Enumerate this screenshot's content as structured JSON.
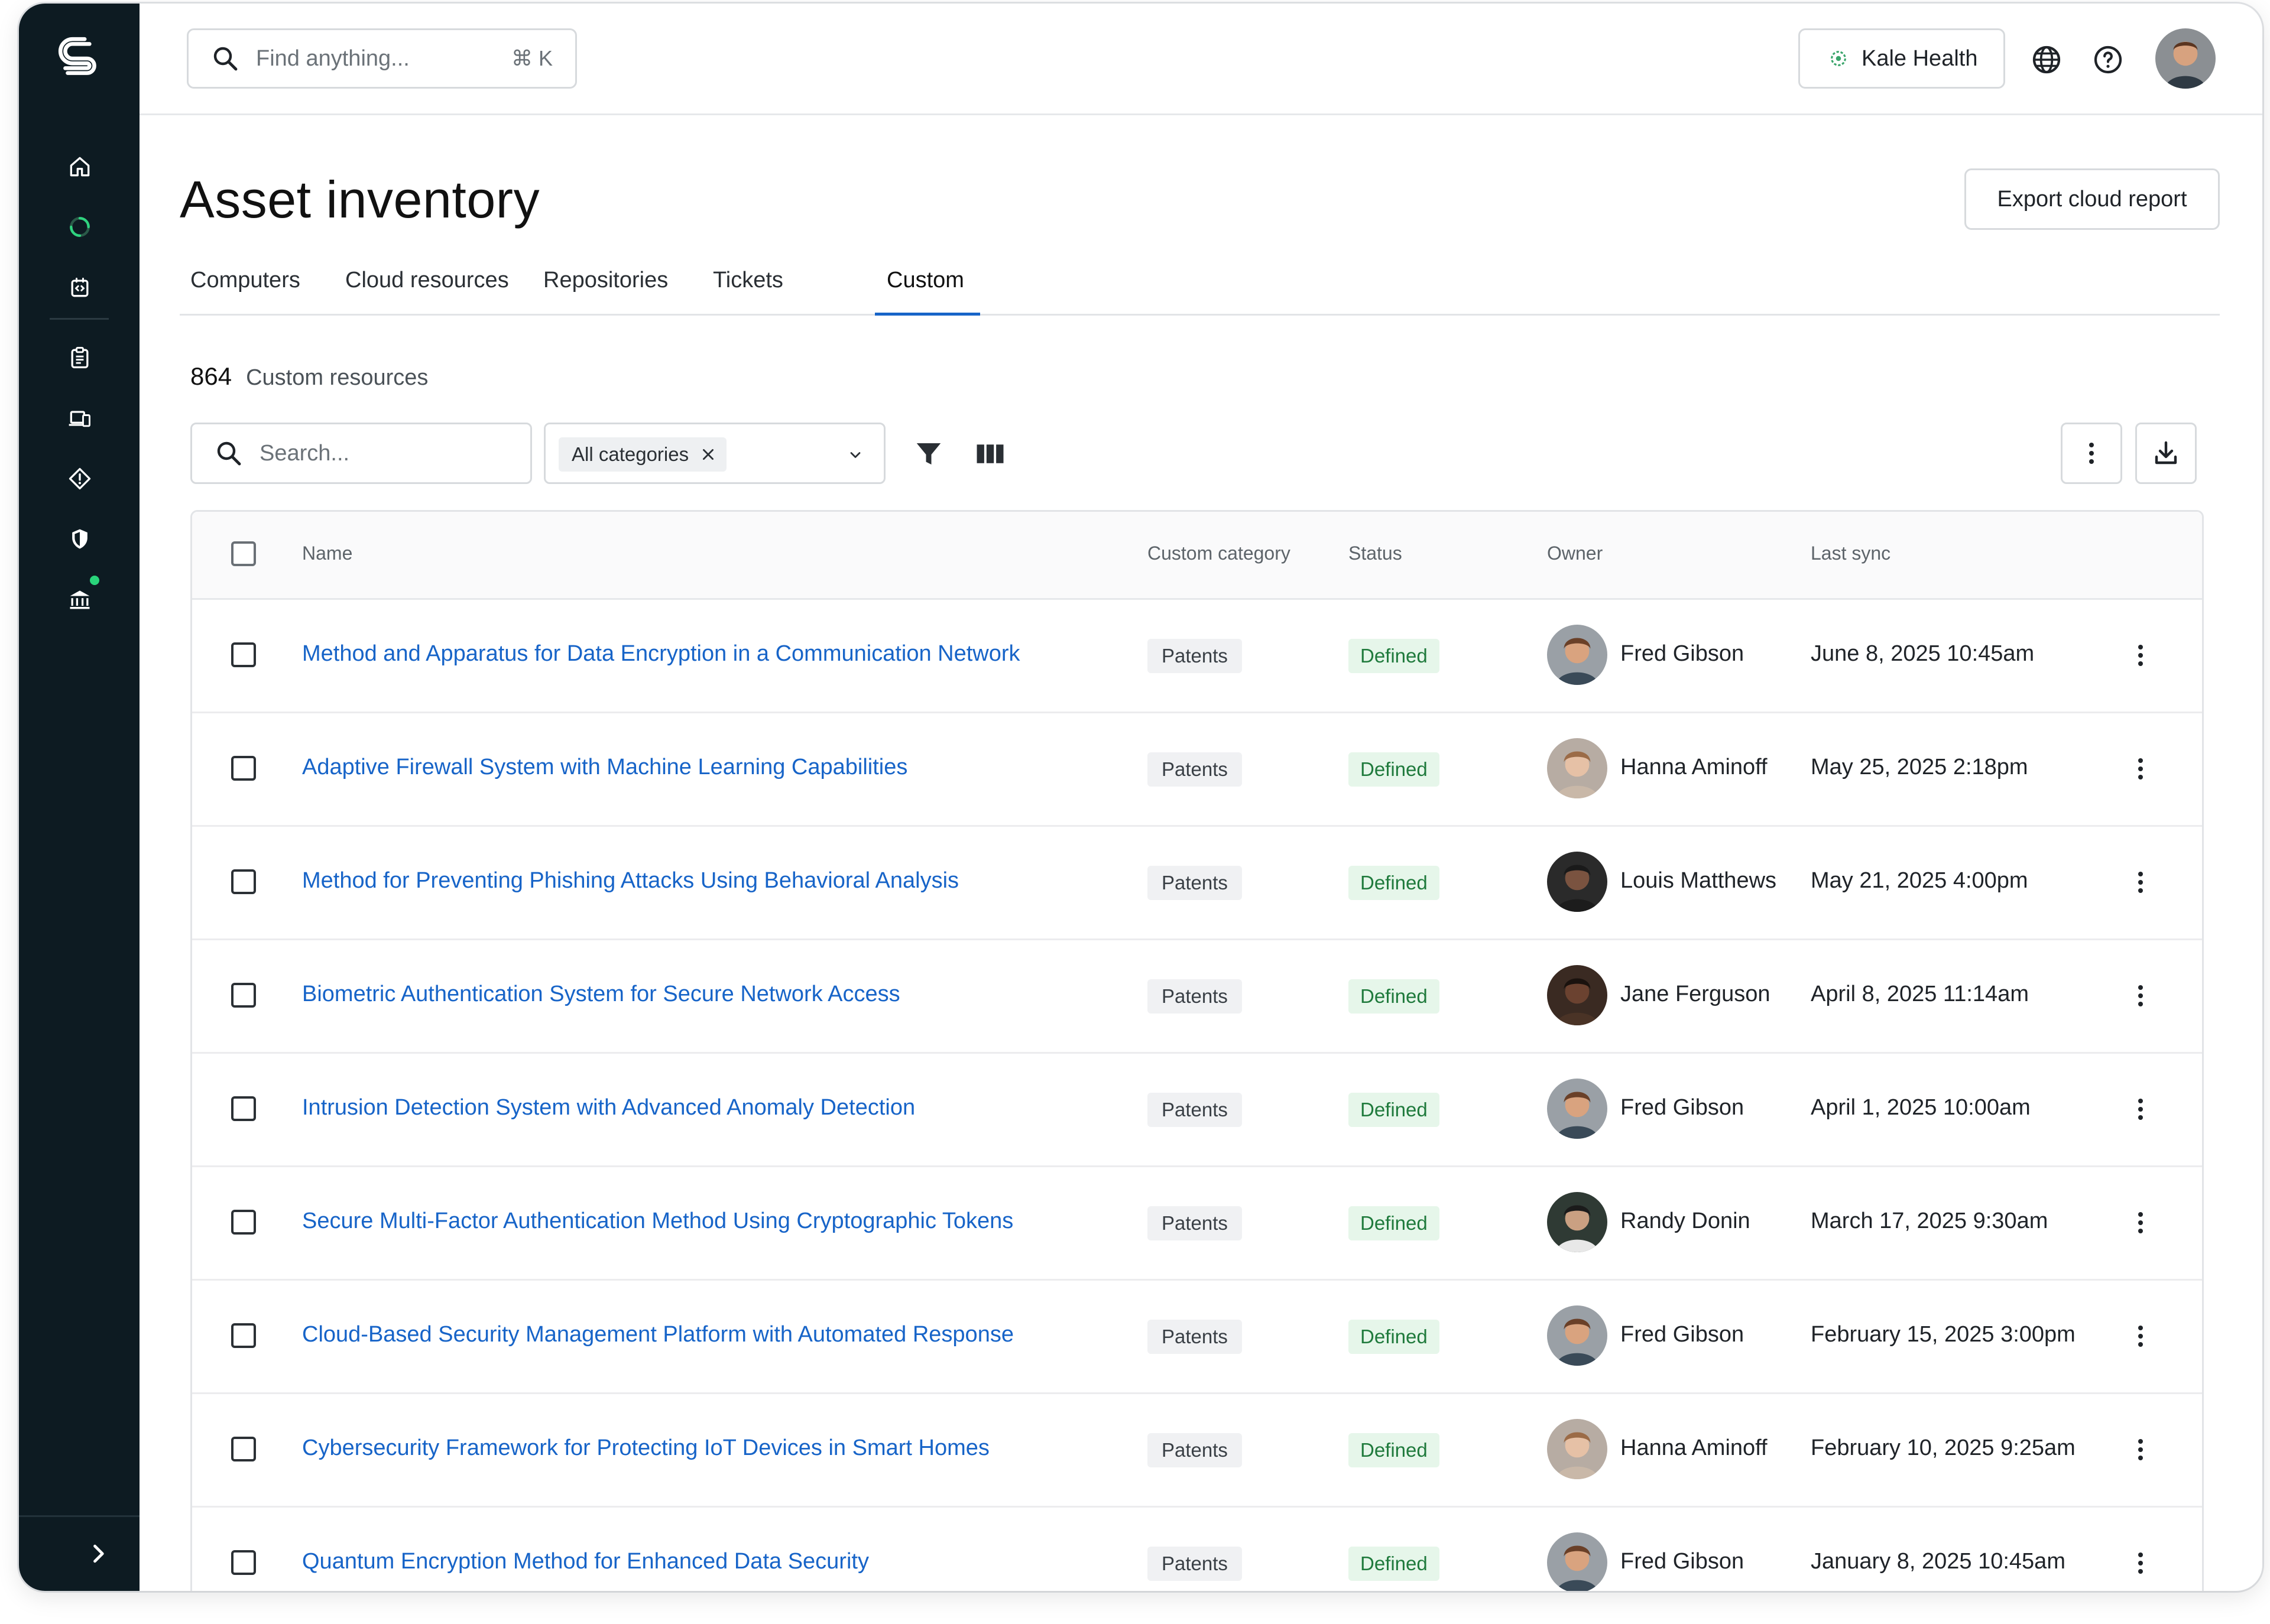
{
  "header": {
    "search_placeholder": "Find anything...",
    "search_shortcut": "⌘ K",
    "org_name": "Kale Health"
  },
  "page": {
    "title": "Asset inventory",
    "export_label": "Export cloud report",
    "tabs": [
      {
        "label": "Computers"
      },
      {
        "label": "Cloud resources"
      },
      {
        "label": "Repositories"
      },
      {
        "label": "Tickets"
      },
      {
        "label": "Custom"
      }
    ],
    "active_tab": "Custom",
    "count": "864",
    "count_label": "Custom resources"
  },
  "filters": {
    "search_placeholder": "Search...",
    "category_chip": "All categories"
  },
  "table": {
    "headers": {
      "name": "Name",
      "category": "Custom category",
      "status": "Status",
      "owner": "Owner",
      "last_sync": "Last sync"
    },
    "rows": [
      {
        "name": "Method and Apparatus for Data Encryption in a Communication Network",
        "category": "Patents",
        "status": "Defined",
        "owner": "Fred Gibson",
        "last_sync": "June 8, 2025 10:45am"
      },
      {
        "name": "Adaptive Firewall System with Machine Learning Capabilities",
        "category": "Patents",
        "status": "Defined",
        "owner": "Hanna Aminoff",
        "last_sync": "May 25, 2025 2:18pm"
      },
      {
        "name": "Method for Preventing Phishing Attacks Using Behavioral Analysis",
        "category": "Patents",
        "status": "Defined",
        "owner": "Louis Matthews",
        "last_sync": "May 21, 2025 4:00pm"
      },
      {
        "name": "Biometric Authentication System for Secure Network Access",
        "category": "Patents",
        "status": "Defined",
        "owner": "Jane Ferguson",
        "last_sync": "April 8, 2025 11:14am"
      },
      {
        "name": "Intrusion Detection System with Advanced Anomaly Detection",
        "category": "Patents",
        "status": "Defined",
        "owner": "Fred Gibson",
        "last_sync": "April 1, 2025 10:00am"
      },
      {
        "name": "Secure Multi-Factor Authentication Method Using Cryptographic Tokens",
        "category": "Patents",
        "status": "Defined",
        "owner": "Randy Donin",
        "last_sync": "March 17, 2025 9:30am"
      },
      {
        "name": "Cloud-Based Security Management Platform with Automated Response",
        "category": "Patents",
        "status": "Defined",
        "owner": "Fred Gibson",
        "last_sync": "February 15, 2025 3:00pm"
      },
      {
        "name": "Cybersecurity Framework for Protecting IoT Devices in Smart Homes",
        "category": "Patents",
        "status": "Defined",
        "owner": "Hanna Aminoff",
        "last_sync": "February 10, 2025 9:25am"
      },
      {
        "name": "Quantum Encryption Method for Enhanced Data Security",
        "category": "Patents",
        "status": "Defined",
        "owner": "Fred Gibson",
        "last_sync": "January 8, 2025 10:45am"
      }
    ]
  },
  "colors": {
    "sidebar_bg": "#0d1b22",
    "link": "#1764c8",
    "status_green_bg": "#e6f6ea",
    "status_green_text": "#1f7a3c",
    "accent_underline": "#1764c8"
  },
  "icons": [
    "logo-icon",
    "home-icon",
    "loading-icon",
    "code-icon",
    "clipboard-icon",
    "devices-icon",
    "diamond-icon",
    "shield-icon",
    "bank-icon",
    "chevron-right-icon",
    "search-icon",
    "globe-icon",
    "help-icon",
    "filter-icon",
    "columns-icon",
    "more-vertical-icon",
    "download-icon",
    "close-icon",
    "chevron-down-icon"
  ]
}
